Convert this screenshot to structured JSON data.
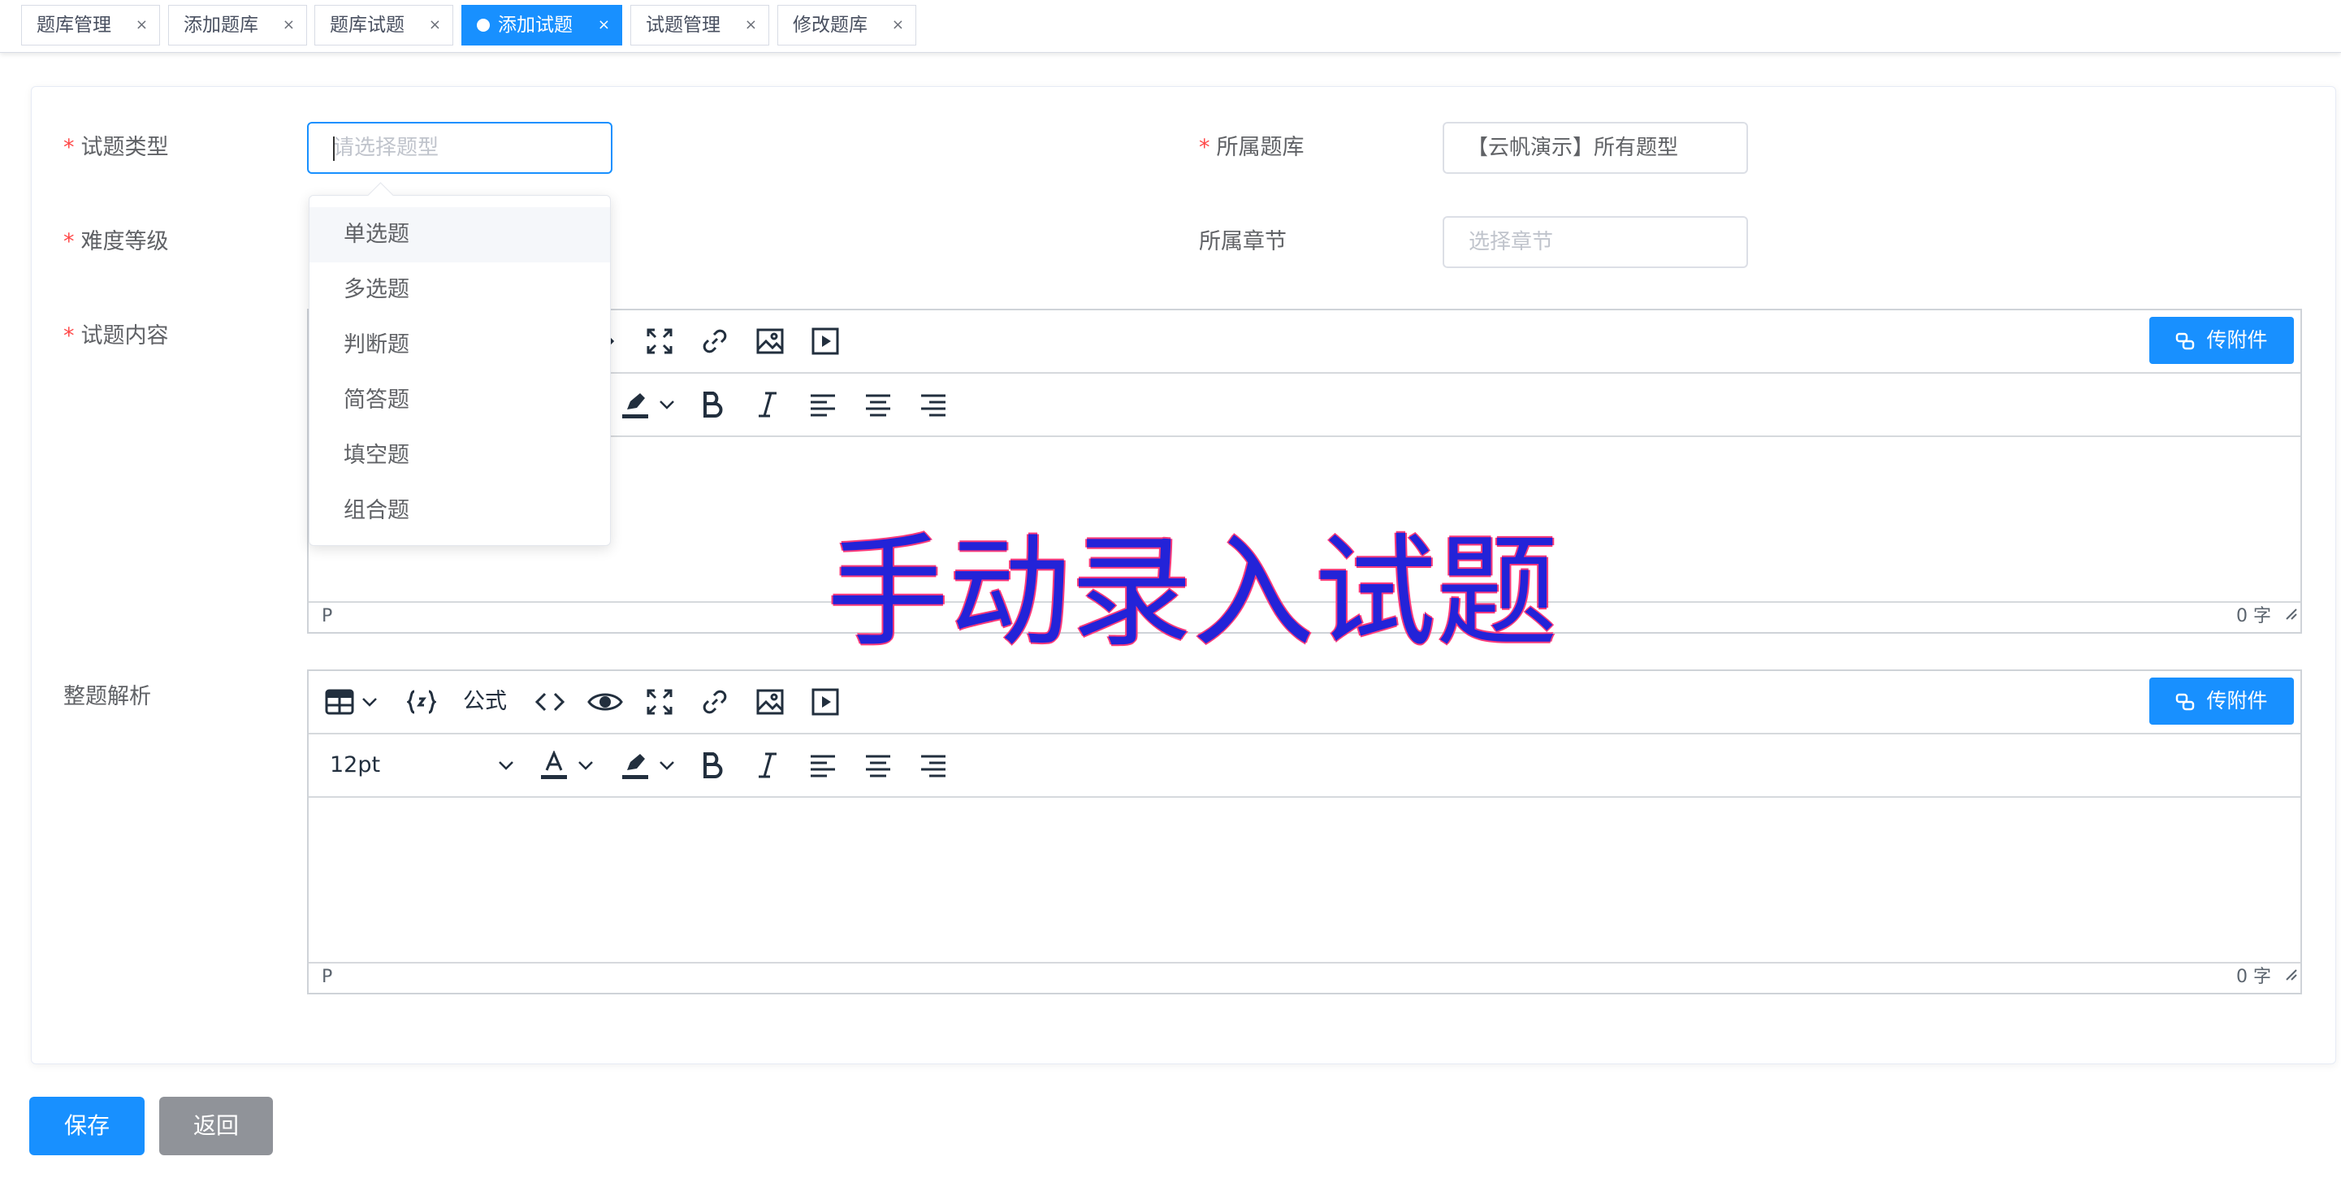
{
  "tabs": [
    {
      "label": "题库管理"
    },
    {
      "label": "添加题库"
    },
    {
      "label": "题库试题"
    },
    {
      "label": "添加试题"
    },
    {
      "label": "试题管理"
    },
    {
      "label": "修改题库"
    }
  ],
  "tab_close": "×",
  "form": {
    "required_mark": "*",
    "type_label": "试题类型",
    "type_placeholder": "请选择题型",
    "bank_label": "所属题库",
    "bank_value": "【云帆演示】所有题型",
    "level_label": "难度等级",
    "chapter_label": "所属章节",
    "chapter_placeholder": "选择章节",
    "content_label": "试题内容",
    "analysis_label": "整题解析"
  },
  "type_options": [
    "单选题",
    "多选题",
    "判断题",
    "简答题",
    "填空题",
    "组合题"
  ],
  "editor": {
    "attach_label": "传附件",
    "formula_label": "公式",
    "font_size": "12pt",
    "status_p": "P",
    "word_count": "0 字"
  },
  "watermark": "手动录入试题",
  "buttons": {
    "save": "保存",
    "back": "返回"
  },
  "colors": {
    "primary": "#1890ff",
    "required": "#ff4949",
    "watermark": "#2323d8",
    "back_button": "#909399"
  }
}
